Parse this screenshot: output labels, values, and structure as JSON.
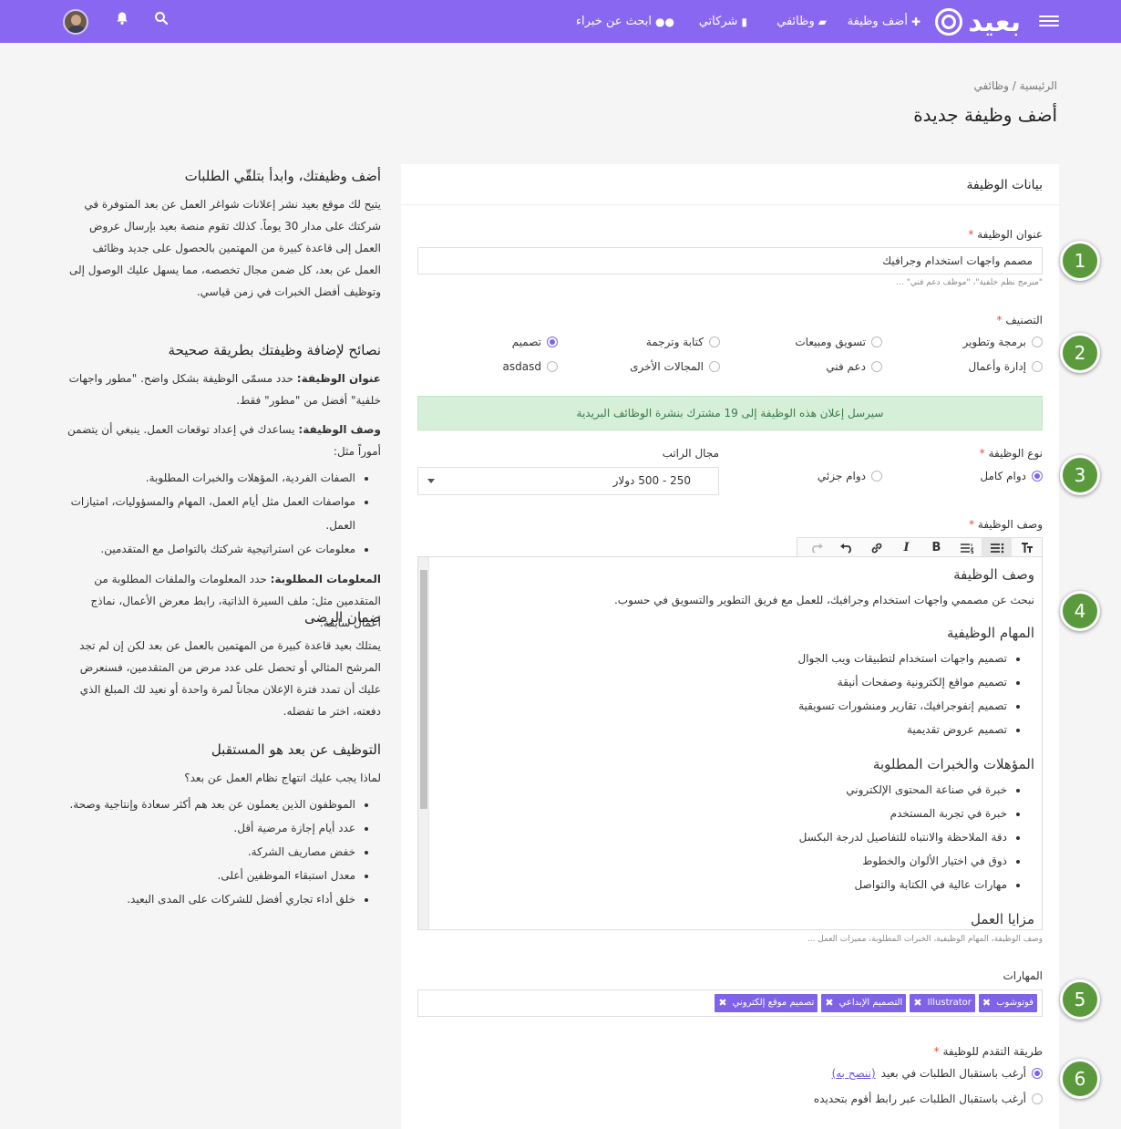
{
  "navbar": {
    "brand": "بعيد",
    "items": [
      {
        "label": "أضف وظيفة",
        "icon": "plus-icon"
      },
      {
        "label": "وظائفي",
        "icon": "folder-icon"
      },
      {
        "label": "شركاتي",
        "icon": "building-icon"
      },
      {
        "label": "ابحث عن خبراء",
        "icon": "users-icon"
      }
    ],
    "icons": [
      "bell-icon",
      "search-icon"
    ],
    "accent": "#8a67f0"
  },
  "breadcrumb": {
    "home": "الرئيسية",
    "sep": "/",
    "current": "وظائفي"
  },
  "page_title": "أضف وظيفة جديدة",
  "sidebar": {
    "s1": {
      "title": "أضف وظيفتك، وابدأ بتلقّي الطلبات",
      "body": "يتيح لك موقع بعيد نشر إعلانات شواغر العمل عن بعد المتوفرة في شركتك على مدار 30 يوماً. كذلك تقوم منصة بعيد بإرسال عروض العمل إلى قاعدة كبيرة من المهتمين بالحصول على جديد وظائف العمل عن بعد، كل ضمن مجال تخصصه، مما يسهل عليك الوصول إلى وتوظيف أفضل الخبرات في زمن قياسي."
    },
    "s2": {
      "title": "نصائح لإضافة وظيفتك بطريقة صحيحة",
      "p1_bold": "عنوان الوظيفة:",
      "p1": " حدد مسمّى الوظيفة بشكل واضح. \"مطور واجهات خلفية\" أفضل من \"مطور\" فقط.",
      "p2_bold": "وصف الوظيفة:",
      "p2": " يساعدك في إعداد توقعات العمل. ينبغي أن يتضمن أموراً مثل:",
      "list": [
        "الصفات الفردية، المؤهلات والخبرات المطلوبة.",
        "مواصفات العمل مثل أيام العمل، المهام والمسؤوليات، امتيازات العمل.",
        "معلومات عن استراتيجية شركتك بالتواصل مع المتقدمين."
      ],
      "p3_bold": "المعلومات المطلوبة:",
      "p3": " حدد المعلومات والملفات المطلوبة من المتقدمين مثل: ملف السيرة الذاتية، رابط معرض الأعمال، نماذج أعمال سابقة."
    },
    "s3": {
      "title": "ضمان الرضى",
      "body": "يمتلك بعيد قاعدة كبيرة من المهتمين بالعمل عن بعد لكن إن لم تجد المرشح المثالي أو تحصل على عدد مرض من المتقدمين، فسنعرض عليك أن تمدد فترة الإعلان مجاناً لمرة واحدة أو نعيد لك المبلغ الذي دفعته، اختر ما تفضله."
    },
    "s4": {
      "title": "التوظيف عن بعد هو المستقبل",
      "intro": "لماذا يجب عليك انتهاج نظام العمل عن بعد؟",
      "list": [
        "الموظفون الذين يعملون عن بعد هم أكثر سعادة وإنتاجية وصحة.",
        "عدد أيام إجازة مرضية أقل.",
        "خفض مصاريف الشركة.",
        "معدل استبقاء الموظفين أعلى.",
        "خلق أداء تجاري أفضل للشركات على المدى البعيد."
      ]
    }
  },
  "form": {
    "header": "بيانات الوظيفة",
    "required_mark": "*",
    "job_title": {
      "label": "عنوان الوظيفة",
      "value": "مصمم واجهات استخدام وجرافيك",
      "hint": "\"مبرمج نظم خلفية\"، \"موظف دعم فني\" ..."
    },
    "category": {
      "label": "التصنيف",
      "options": [
        {
          "label": "برمجة وتطوير",
          "checked": false
        },
        {
          "label": "تسويق ومبيعات",
          "checked": false
        },
        {
          "label": "كتابة وترجمة",
          "checked": false
        },
        {
          "label": "تصميم",
          "checked": true
        },
        {
          "label": "إدارة وأعمال",
          "checked": false
        },
        {
          "label": "دعم فني",
          "checked": false
        },
        {
          "label": "المجالات الأخرى",
          "checked": false
        },
        {
          "label": "asdasd",
          "checked": false
        }
      ]
    },
    "alert": "سيرسل إعلان هذه الوظيفة إلى 19 مشترك بنشرة الوظائف البريدية",
    "job_type": {
      "label": "نوع الوظيفة",
      "options": [
        {
          "label": "دوام كامل",
          "checked": true
        },
        {
          "label": "دوام جزئي",
          "checked": false
        }
      ]
    },
    "salary": {
      "label": "مجال الراتب",
      "value": "250 - 500 دولار"
    },
    "description": {
      "label": "وصف الوظيفة",
      "toolbar": [
        "heading-icon",
        "bullet-list-icon",
        "numbered-list-icon",
        "bold-icon",
        "italic-icon",
        "link-icon",
        "undo-icon",
        "redo-icon"
      ],
      "h1": "وصف الوظيفة",
      "p1": "نبحث عن مصممي واجهات استخدام وجرافيك، للعمل مع فريق التطوير والتسويق في حسوب.",
      "h2": "المهام الوظيفية",
      "tasks": [
        "تصميم واجهات استخدام لتطبيقات ويب الجوال",
        "تصميم مواقع إلكترونية وصفحات أنيقة",
        "تصميم إنفوجرافيك، تقارير ومنشورات تسويقية",
        "تصميم عروض تقديمية"
      ],
      "h3": "المؤهلات والخبرات المطلوبة",
      "quals": [
        "خبرة في صناعة المحتوى الإلكتروني",
        "خبرة في تجربة المستخدم",
        "دقة الملاحظة والانتباه للتفاصيل لدرجة البكسل",
        "ذوق في اختيار الألوان والخطوط",
        "مهارات عالية في الكتابة والتواصل"
      ],
      "h4": "مزايا العمل",
      "hint": "وصف الوظيفة، المهام الوظيفية، الخبرات المطلوبة، مميزات العمل ..."
    },
    "skills": {
      "label": "المهارات",
      "tags": [
        "فوتوشوب",
        "Illustrator",
        "التصميم الإبداعي",
        "تصميم موقع إلكتروني"
      ],
      "remove_glyph": "✖"
    },
    "apply_method": {
      "label": "طريقة التقدم للوظيفة",
      "opt1": "أرغب باستقبال الطلبات في بعيد",
      "opt1_link": "(ننصح به)",
      "opt2": "أرغب باستقبال الطلبات عبر رابط أقوم بتحديده"
    }
  },
  "badges": [
    "1",
    "2",
    "3",
    "4",
    "5",
    "6"
  ]
}
